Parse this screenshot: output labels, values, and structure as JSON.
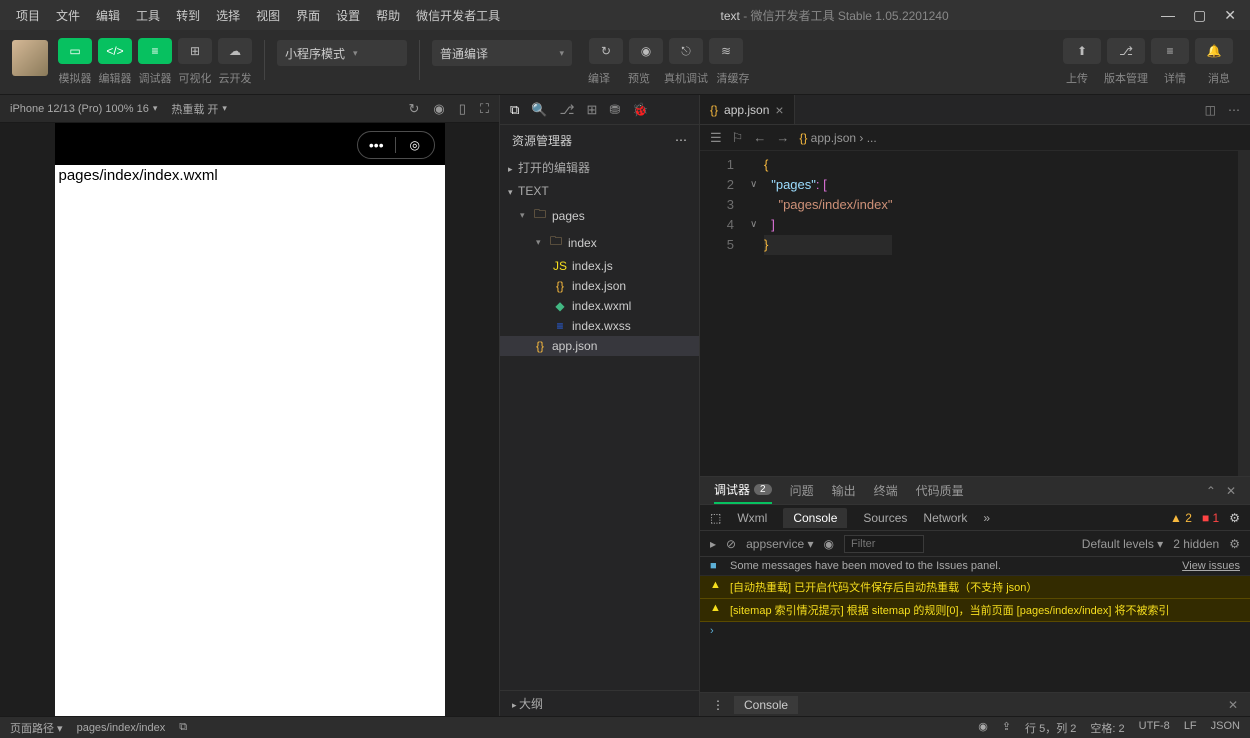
{
  "menubar": {
    "items": [
      "项目",
      "文件",
      "编辑",
      "工具",
      "转到",
      "选择",
      "视图",
      "界面",
      "设置",
      "帮助",
      "微信开发者工具"
    ],
    "project": "text",
    "title_suffix": " - 微信开发者工具 Stable 1.05.2201240"
  },
  "toolbar": {
    "mode_labels": [
      "模拟器",
      "编辑器",
      "调试器",
      "可视化",
      "云开发"
    ],
    "dropdown_mode": "小程序模式",
    "dropdown_compile": "普通编译",
    "action_labels": [
      "编译",
      "预览",
      "真机调试",
      "清缓存"
    ],
    "right_labels": [
      "上传",
      "版本管理",
      "详情",
      "消息"
    ]
  },
  "sim_header": {
    "device": "iPhone 12/13 (Pro) 100% 16",
    "hotreload": "热重载 开"
  },
  "phone": {
    "content_text": "pages/index/index.wxml"
  },
  "explorer": {
    "title": "资源管理器",
    "open_editors": "打开的编辑器",
    "root": "TEXT",
    "folders": {
      "pages": "pages",
      "index": "index"
    },
    "files": [
      "index.js",
      "index.json",
      "index.wxml",
      "index.wxss"
    ],
    "app_json": "app.json",
    "outline": "大纲"
  },
  "editor": {
    "tab": "app.json",
    "breadcrumb": "app.json › ...",
    "code": {
      "line1": "{",
      "line2_key": "\"pages\"",
      "line2_rest": ": [",
      "line3": "\"pages/index/index\"",
      "line4": "]",
      "line5": "}"
    }
  },
  "debugger": {
    "tabs": [
      "调试器",
      "问题",
      "输出",
      "终端",
      "代码质量"
    ],
    "badge": "2",
    "subtabs": [
      "Wxml",
      "Console",
      "Sources",
      "Network"
    ],
    "warn_count": "2",
    "err_count": "1",
    "context": "appservice",
    "filter_placeholder": "Filter",
    "levels": "Default levels ▾",
    "hidden": "2 hidden",
    "msg_info": "Some messages have been moved to the Issues panel.",
    "view_issues": "View issues",
    "msg_warn1": "[自动热重载] 已开启代码文件保存后自动热重载（不支持 json）",
    "msg_warn2": "[sitemap 索引情况提示] 根据 sitemap 的规则[0]，当前页面 [pages/index/index] 将不被索引",
    "bottom_tab": "Console"
  },
  "statusbar": {
    "path_label": "页面路径",
    "path": "pages/index/index",
    "pos": "行 5，列 2",
    "spaces": "空格: 2",
    "encoding": "UTF-8",
    "eol": "LF",
    "lang": "JSON"
  }
}
